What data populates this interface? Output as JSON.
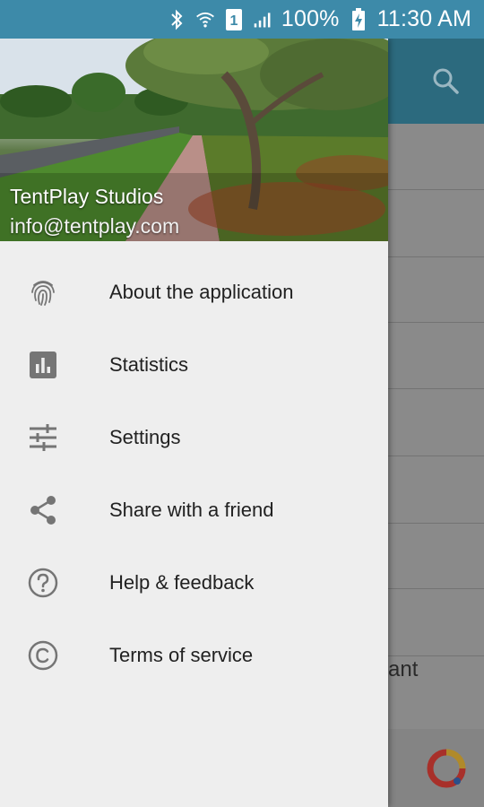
{
  "status_bar": {
    "battery": "100%",
    "time": "11:30 AM",
    "sim_slot": "1",
    "icons": [
      "bluetooth-icon",
      "wifi-icon",
      "sim-icon",
      "signal-icon",
      "battery-charging-icon"
    ]
  },
  "drawer": {
    "header": {
      "name": "TentPlay Studios",
      "email": "info@tentplay.com"
    },
    "items": [
      {
        "label": "About the application",
        "icon": "fingerprint-icon"
      },
      {
        "label": "Statistics",
        "icon": "bar-chart-icon"
      },
      {
        "label": "Settings",
        "icon": "tune-sliders-icon"
      },
      {
        "label": "Share with a friend",
        "icon": "share-icon"
      },
      {
        "label": "Help & feedback",
        "icon": "help-icon"
      },
      {
        "label": "Terms of service",
        "icon": "copyright-icon"
      }
    ]
  },
  "background": {
    "partial_text": "ant",
    "icons": [
      "search-icon",
      "ad-logo-icon"
    ]
  },
  "colors": {
    "status_bar": "#3d8aa9",
    "toolbar_dimmed": "#2c6a7e",
    "drawer_bg": "#eeeeee",
    "icon_gray": "#757575",
    "text_dark": "#212121"
  }
}
